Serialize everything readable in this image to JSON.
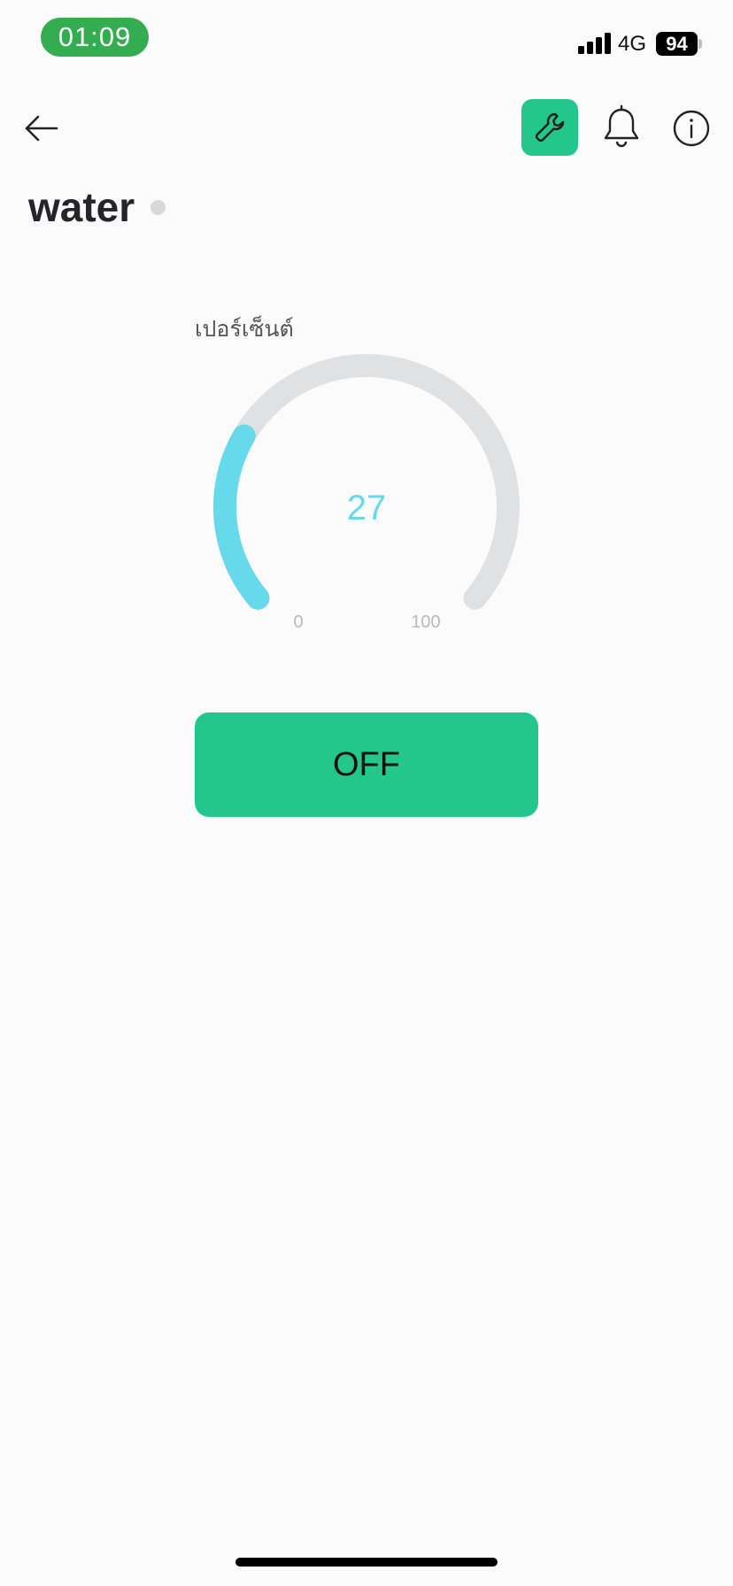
{
  "status_bar": {
    "time": "01:09",
    "network": "4G",
    "battery": "94",
    "signal_icon": "cellular-signal-icon",
    "pill_color": "#34ac50"
  },
  "header": {
    "back_icon": "arrow-left-icon",
    "tools_icon": "wrench-icon",
    "bell_icon": "bell-icon",
    "info_icon": "info-icon",
    "accent_color": "#23c78d"
  },
  "device": {
    "name": "water",
    "status_color": "#d8d8d8"
  },
  "gauge": {
    "label": "เปอร์เซ็นต์",
    "value": "27",
    "min": "0",
    "max": "100",
    "value_color": "#66d9ea",
    "track_color": "#e0e1e3"
  },
  "switch": {
    "label": "OFF",
    "color": "#23c78d"
  }
}
